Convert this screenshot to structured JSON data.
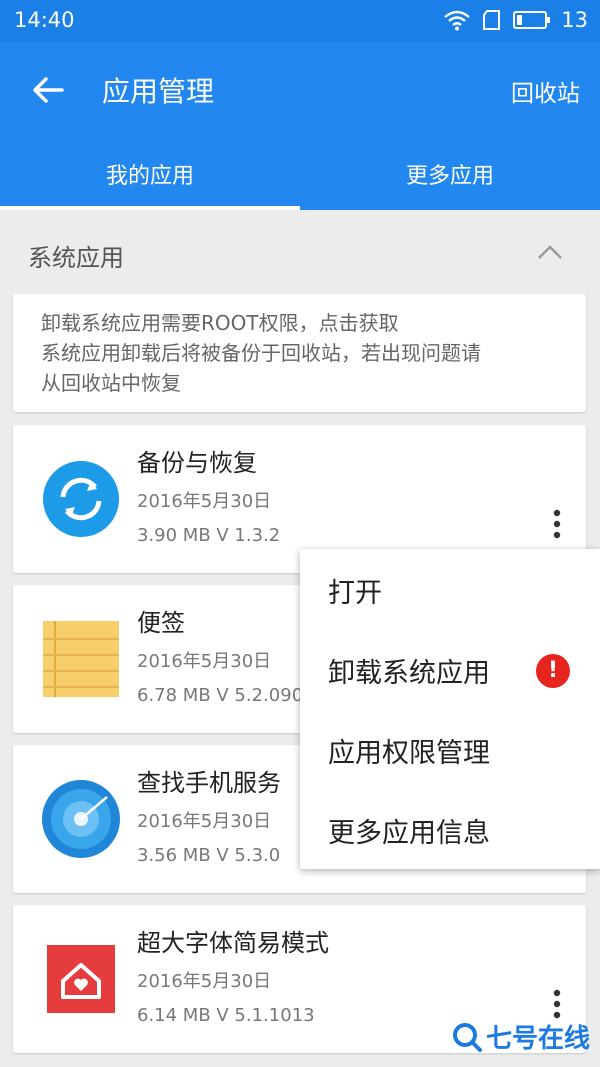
{
  "status": {
    "time": "14:40",
    "battery": "13"
  },
  "appbar": {
    "title": "应用管理",
    "recycle": "回收站"
  },
  "tabs": [
    {
      "label": "我的应用"
    },
    {
      "label": "更多应用"
    }
  ],
  "section": {
    "title": "系统应用"
  },
  "notice": [
    "卸载系统应用需要ROOT权限，点击获取",
    "系统应用卸载后将被备份于回收站，若出现问题请",
    "从回收站中恢复"
  ],
  "apps": [
    {
      "name": "备份与恢复",
      "date": "2016年5月30日",
      "meta": "3.90 MB   V 1.3.2"
    },
    {
      "name": "便签",
      "date": "2016年5月30日",
      "meta": "6.78 MB   V 5.2.090"
    },
    {
      "name": "查找手机服务",
      "date": "2016年5月30日",
      "meta": "3.56 MB   V 5.3.0"
    },
    {
      "name": "超大字体简易模式",
      "date": "2016年5月30日",
      "meta": "6.14 MB   V 5.1.1013"
    }
  ],
  "menu": [
    "打开",
    "卸载系统应用",
    "应用权限管理",
    "更多应用信息"
  ],
  "menu_warning": "!",
  "watermark": "七号在线",
  "colors": {
    "primary": "#2288f0",
    "statusbar": "#1a7fe6",
    "warning": "#e8241f"
  }
}
